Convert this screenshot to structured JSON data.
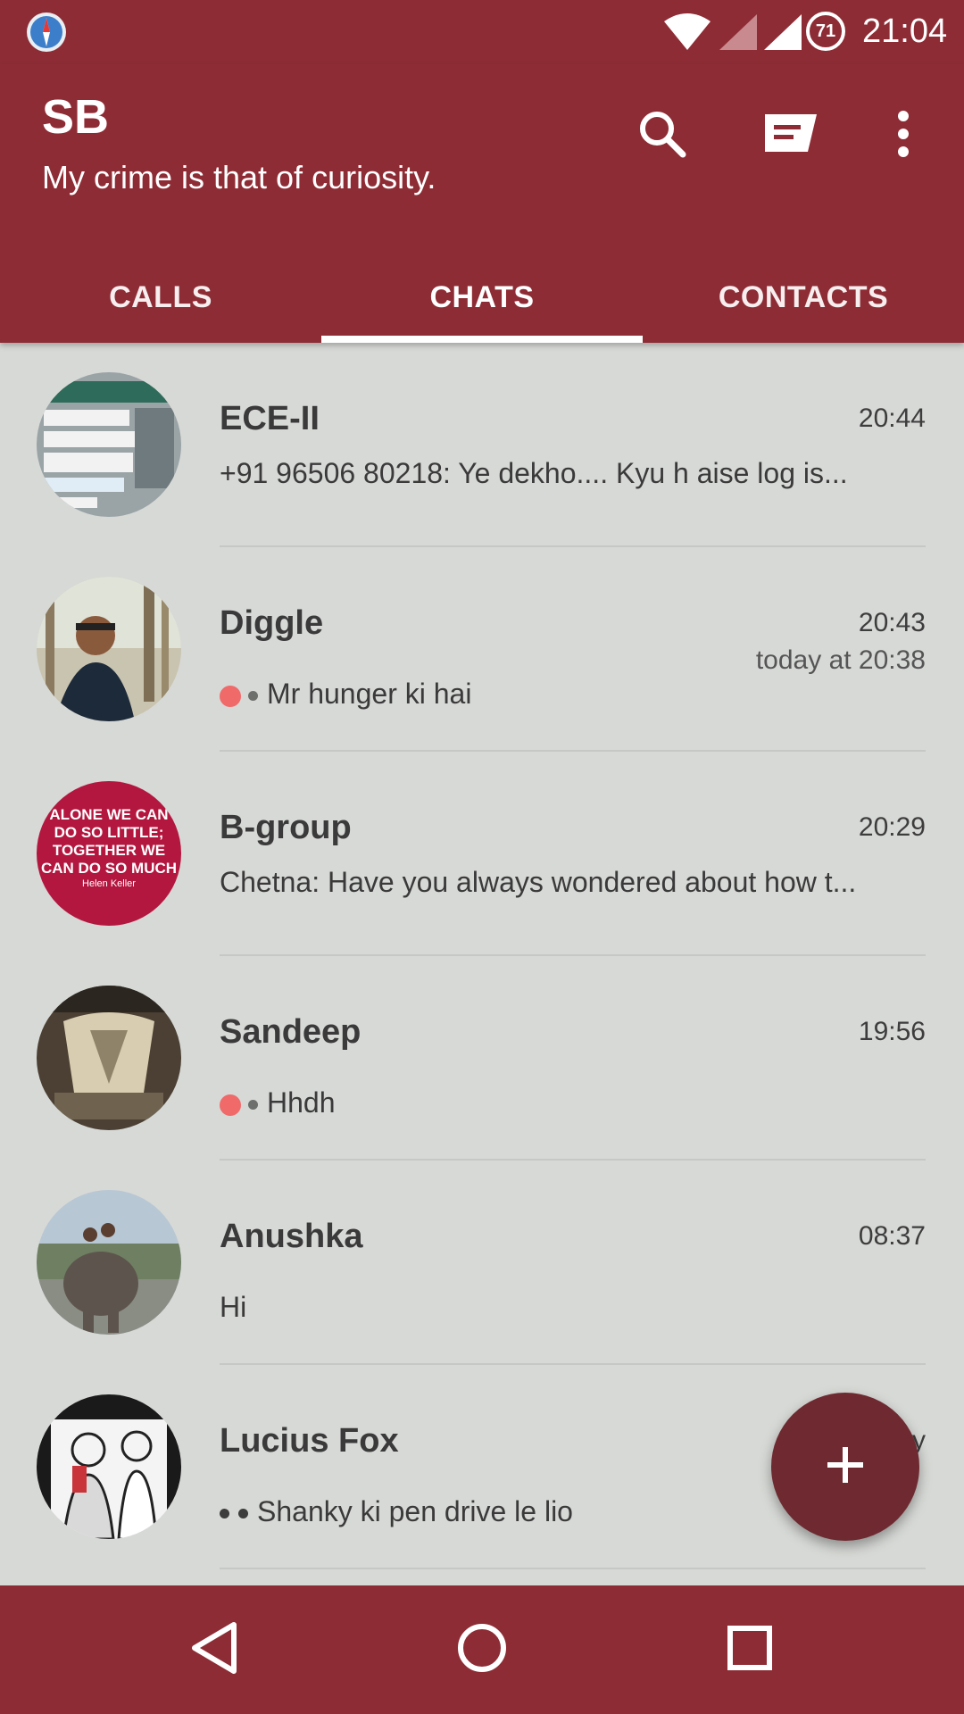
{
  "status_bar": {
    "time": "21:04",
    "battery_level": "71",
    "icons": [
      "compass-icon",
      "wifi-icon",
      "signal-icon",
      "battery-icon"
    ]
  },
  "header": {
    "title": "SB",
    "subtitle": "My crime is that of curiosity.",
    "actions": [
      "search-icon",
      "new-message-icon",
      "overflow-menu-icon"
    ]
  },
  "tabs": [
    {
      "label": "CALLS",
      "active": false
    },
    {
      "label": "CHATS",
      "active": true
    },
    {
      "label": "CONTACTS",
      "active": false
    }
  ],
  "chats": [
    {
      "name": "ECE-II",
      "time": "20:44",
      "preview": "+91 96506 80218: Ye dekho.... Kyu h aise log is..."
    },
    {
      "name": "Diggle",
      "time": "20:43",
      "subtime": "today at 20:38",
      "preview": "Mr hunger ki hai",
      "status": "unread"
    },
    {
      "name": "B-group",
      "time": "20:29",
      "preview": "Chetna: Have you always wondered about how t...",
      "avatar_text": [
        "ALONE WE CAN",
        "DO SO LITTLE;",
        "TOGETHER WE",
        "CAN DO SO MUCH",
        "Helen Keller"
      ]
    },
    {
      "name": "Sandeep",
      "time": "19:56",
      "preview": "Hhdh",
      "status": "unread"
    },
    {
      "name": "Anushka",
      "time": "08:37",
      "preview": "Hi"
    },
    {
      "name": "Lucius Fox",
      "time": "y",
      "preview": "Shanky ki pen drive le lio",
      "status": "read"
    }
  ],
  "colors": {
    "primary": "#8e2c35",
    "fab": "#6e2a30",
    "list_bg": "#d7d9d6",
    "unread_dot": "#f06a6a"
  }
}
